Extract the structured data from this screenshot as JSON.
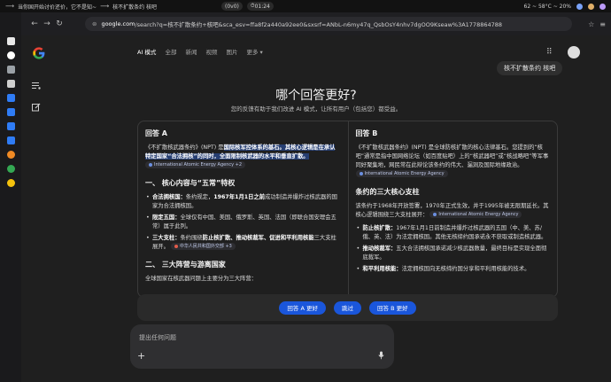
{
  "system": {
    "window_title": "当你国开始讨价还价，它不是知~",
    "active_tab": "核不扩散条约 核吧",
    "workspace": "(0v0)",
    "clock": "01:24",
    "stats": "62 ~ 58°C ~ 20%"
  },
  "browser": {
    "url_domain": "google.com",
    "url_path": "/search?q=核不扩散条约+核吧&sca_esv=ffa8f2a440a92ee0&sxsrf=ANbL-n6my47q_QsbOsY4nhv7dgOO9Kseaw%3A1778864788"
  },
  "google": {
    "tabs": [
      "AI 模式",
      "全部",
      "新闻",
      "视频",
      "图片",
      "更多 ▾"
    ],
    "query": "核不扩散条约 核吧"
  },
  "feedback": {
    "title": "哪个回答更好?",
    "subtitle": "您的反馈有助于我们改进 AI 模式，让所有用户（包括您）都受益。"
  },
  "answer_a": {
    "label": "回答 A",
    "intro_prefix": "《不扩散核武器条约》(NPT) 是",
    "intro_highlight": "国际核军控体系的基石。其核心逻辑是在承认特定国家“合法拥核”的同时，全面限制核武器的水平和垂直扩散。",
    "intro_source": "International Atomic Energy Agency +2",
    "section1": "一、 核心内容与“五常”特权",
    "bullets": [
      {
        "term": "合法拥核国：",
        "text": "条约规定，",
        "bold": "1967年1月1日之前",
        "rest": "成功制造并爆炸过核武器的国家为合法拥核国。"
      },
      {
        "term": "限定五国：",
        "text": "全球仅有中国、美国、俄罗斯、英国、法国（即联合国安理会五常）属于此列。",
        "bold": "",
        "rest": ""
      },
      {
        "term": "三大支柱：",
        "text": "条约围绕",
        "bold": "防止核扩散、推动核裁军、促进和平利用核能",
        "rest": "三大支柱展开。"
      }
    ],
    "bullet3_source": "中华人民共和国外交部 +3",
    "section2": "二、 三大阵营与游离国家",
    "section2_text": "全球国家在核武器问题上主要分为三大阵营："
  },
  "answer_b": {
    "label": "回答 B",
    "intro": "《不扩散核武器条约》(NPT) 是全球防核扩散的核心法律基石。您提到的“核吧”通常是指中国网络论坛（如百度贴吧）上的“核武器吧”或“核战略吧”等军事同好聚集地，网民常在此辩论该条约的伟大、漏洞及国际地缘政治。",
    "intro_source": "International Atomic Energy Agency",
    "section1": "条约的三大核心支柱",
    "section1_text": "该条约于1968年开放签署，1970年正式生效，并于1995年被无限期延长。其核心逻辑围绕三大支柱展开：",
    "section1_source": "International Atomic Energy Agency",
    "bullets": [
      {
        "term": "防止核扩散：",
        "text": "1967年1月1日前制造并爆炸过核武器的五国（中、美、苏/俄、英、法）为法定拥核国。其他无核缔约国承诺永不获取或制造核武器。"
      },
      {
        "term": "推动核裁军：",
        "text": "五大合法拥核国承诺减少核武器数量，最终目标是实现全面彻底裁军。"
      },
      {
        "term": "和平利用核能：",
        "text": "法定拥核国向无核缔约国分享和平利用核能的技术。"
      }
    ]
  },
  "choices": {
    "a_better": "回答 A 更好",
    "skip": "跳过",
    "b_better": "回答 B 更好"
  },
  "ask": {
    "placeholder": "提出任何问题"
  }
}
